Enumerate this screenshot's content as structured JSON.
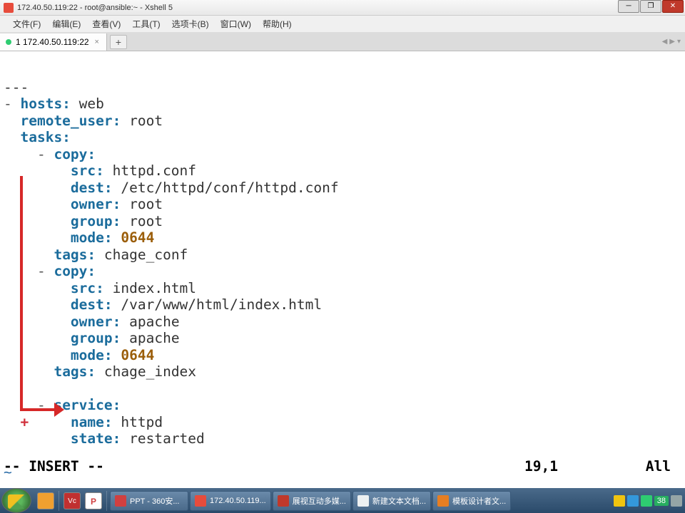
{
  "window": {
    "title": "172.40.50.119:22 - root@ansible:~ - Xshell 5"
  },
  "menu": {
    "file": "文件(F)",
    "edit": "编辑(E)",
    "view": "查看(V)",
    "tools": "工具(T)",
    "tabs": "选项卡(B)",
    "window": "窗口(W)",
    "help": "帮助(H)"
  },
  "tab": {
    "label": "1 172.40.50.119:22"
  },
  "code": {
    "l1": "---",
    "l2_hosts": "hosts:",
    "l2_val": " web",
    "l3_key": "remote_user:",
    "l3_val": " root",
    "l4_key": "tasks:",
    "l5_key": "copy:",
    "l6_key": "src:",
    "l6_val": " httpd.conf",
    "l7_key": "dest:",
    "l7_val": " /etc/httpd/conf/httpd.conf",
    "l8_key": "owner:",
    "l8_val": " root",
    "l9_key": "group:",
    "l9_val": " root",
    "l10_key": "mode:",
    "l10_val": " 0644",
    "l11_key": "tags:",
    "l11_val": " chage_conf",
    "l12_key": "copy:",
    "l13_key": "src:",
    "l13_val": " index.html",
    "l14_key": "dest:",
    "l14_val": " /var/www/html/index.html",
    "l15_key": "owner:",
    "l15_val": " apache",
    "l16_key": "group:",
    "l16_val": " apache",
    "l17_key": "mode:",
    "l17_val": " 0644",
    "l18_key": "tags:",
    "l18_val": " chage_index",
    "l19_key": "service:",
    "l20_key": "name:",
    "l20_val": " httpd",
    "l21_key": "state:",
    "l21_val": " restarted",
    "tilde": "~",
    "cursor_plus": "+"
  },
  "status": {
    "mode": "-- INSERT --",
    "pos": "19,1",
    "scroll": "All"
  },
  "taskbar": {
    "items": [
      "PPT - 360安...",
      "172.40.50.119...",
      "展视互动多媒...",
      "新建文本文档...",
      "模板设计者文..."
    ],
    "tray_num": "38"
  }
}
